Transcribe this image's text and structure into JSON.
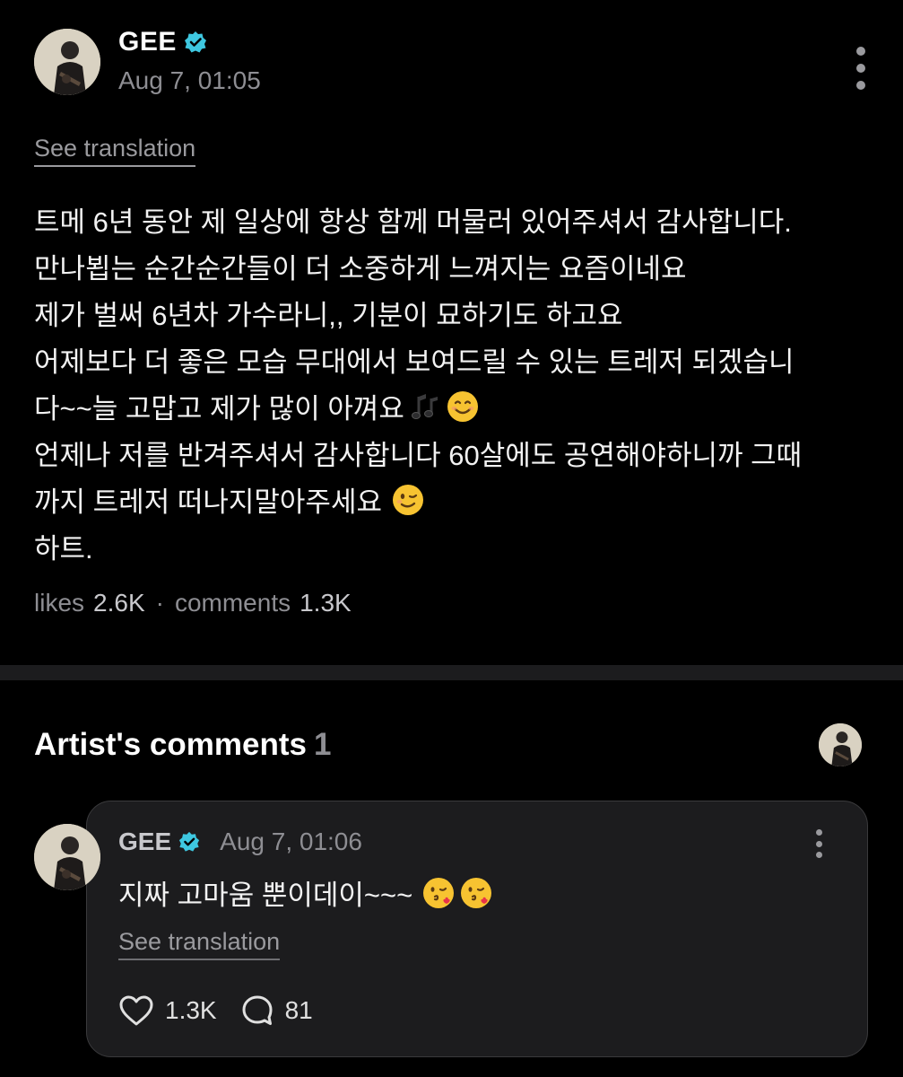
{
  "post": {
    "author": "GEE",
    "time": "Aug 7, 01:05",
    "see_translation": "See translation",
    "lines": [
      "트메 6년 동안 제 일상에 항상 함께 머물러 있어주셔서 감사합니다.",
      "만나뵙는 순간순간들이 더 소중하게 느껴지는 요즘이네요",
      "제가 벌써 6년차 가수라니,, 기분이 묘하기도 하고요",
      "어제보다 더 좋은 모습 무대에서 보여드릴 수 있는 트레저 되겠습니",
      "다~~늘 고맙고 제가 많이 아껴요",
      "언제나 저를 반겨주셔서 감사합니다 60살에도 공연해야하니까 그때",
      "까지 트레저 떠나지말아주세요",
      "하트."
    ],
    "emojis": {
      "line5": [
        "musical-notes",
        "smiling-face"
      ],
      "line7": [
        "winking-face"
      ]
    },
    "stats": {
      "likes_label": "likes",
      "likes_value": "2.6K",
      "separator": "·",
      "comments_label": "comments",
      "comments_value": "1.3K"
    }
  },
  "artist_comments": {
    "title": "Artist's comments",
    "count": "1",
    "comment": {
      "author": "GEE",
      "time": "Aug 7, 01:06",
      "text": "지짜 고마움 뿐이데이~~~",
      "emojis": [
        "kissing-face-with-heart",
        "kissing-face-with-heart"
      ],
      "see_translation": "See translation",
      "likes": "1.3K",
      "replies": "81"
    }
  },
  "colors": {
    "background": "#000000",
    "card": "#1c1c1e",
    "verified": "#3ec7e0",
    "muted_text": "#8e8e93"
  }
}
